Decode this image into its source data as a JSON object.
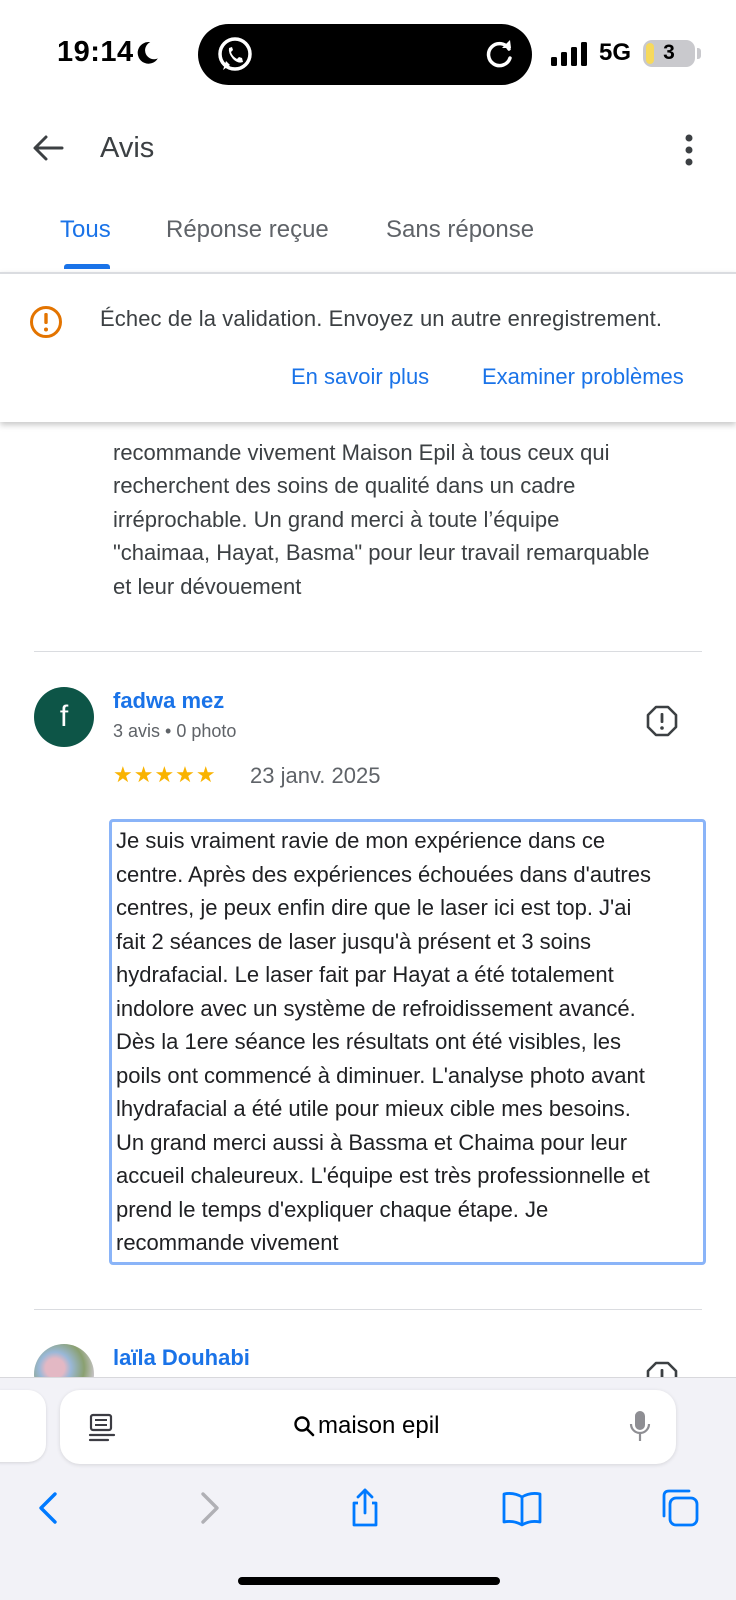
{
  "status_bar": {
    "time": "19:14",
    "network": "5G",
    "battery": "3"
  },
  "app_bar": {
    "title": "Avis"
  },
  "tabs": [
    {
      "label": "Tous",
      "active": true
    },
    {
      "label": "Réponse reçue",
      "active": false
    },
    {
      "label": "Sans réponse",
      "active": false
    }
  ],
  "banner": {
    "message": "Échec de la validation. Envoyez un autre enregistrement.",
    "learn_more": "En savoir plus",
    "review_issues": "Examiner problèmes"
  },
  "previous_review": {
    "lines": [
      "recommande vivement Maison Epil à tous ceux qui",
      "recherchent des soins de qualité dans un cadre",
      "irréprochable. Un grand merci à toute l’équipe",
      "\"chaimaa, Hayat, Basma\" pour leur travail remarquable",
      "et leur dévouement"
    ]
  },
  "reviews": [
    {
      "initial": "f",
      "author": "fadwa mez",
      "meta": "3 avis • 0 photo",
      "rating": 5,
      "stars": "★★★★★",
      "date": "23 janv. 2025",
      "lines": [
        "Je suis vraiment ravie de mon expérience dans ce",
        "centre. Après des expériences échouées dans d'autres",
        "centres, je peux enfin dire que le laser ici est top. J'ai",
        "fait 2 séances de laser jusqu'à présent et 3 soins",
        "hydrafacial. Le laser fait par Hayat a été totalement",
        "indolore avec un système de refroidissement avancé.",
        "Dès la 1ere séance les résultats ont été visibles, les",
        "poils ont commencé à diminuer. L'analyse photo avant",
        "lhydrafacial a été utile pour mieux cible mes besoins.",
        "Un grand merci aussi à Bassma et Chaima pour leur",
        "accueil chaleureux. L'équipe est très professionnelle et",
        "prend le temps d'expliquer chaque étape. Je",
        "recommande vivement"
      ]
    },
    {
      "author": "laïla Douhabi"
    }
  ],
  "browser": {
    "address": "maison epil"
  },
  "colors": {
    "accent": "#1a73e8",
    "warning": "#e37400",
    "star": "#f9b300",
    "avatar": "#0d5547"
  },
  "icons": [
    "moon-icon",
    "whatsapp-icon",
    "reload-icon",
    "signal-icon",
    "back-arrow-icon",
    "more-vert-icon",
    "warning-icon",
    "report-icon",
    "reader-icon",
    "search-icon",
    "mic-icon",
    "back-icon",
    "forward-icon",
    "share-icon",
    "bookmarks-icon",
    "tabs-icon"
  ]
}
